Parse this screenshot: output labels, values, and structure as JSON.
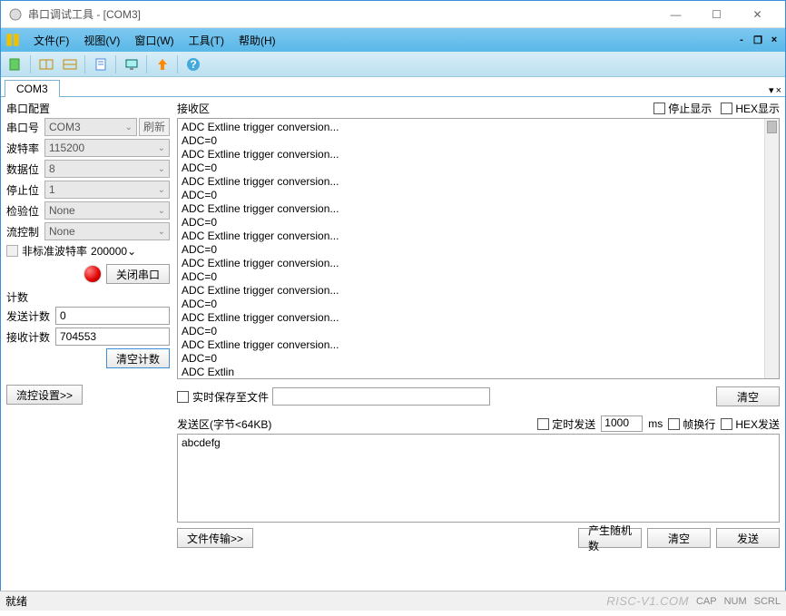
{
  "window": {
    "title": "串口调试工具 - [COM3]"
  },
  "menu": {
    "file": "文件(F)",
    "view": "视图(V)",
    "window": "窗口(W)",
    "tools": "工具(T)",
    "help": "帮助(H)"
  },
  "tab": {
    "label": "COM3"
  },
  "serial_config": {
    "title": "串口配置",
    "port_label": "串口号",
    "port_value": "COM3",
    "refresh": "刷新",
    "baud_label": "波特率",
    "baud_value": "115200",
    "databits_label": "数据位",
    "databits_value": "8",
    "stopbits_label": "停止位",
    "stopbits_value": "1",
    "parity_label": "检验位",
    "parity_value": "None",
    "flow_label": "流控制",
    "flow_value": "None",
    "nonstd_label": "非标准波特率",
    "nonstd_value": "200000",
    "close_port": "关闭串口"
  },
  "counts": {
    "title": "计数",
    "send_label": "发送计数",
    "send_value": "0",
    "recv_label": "接收计数",
    "recv_value": "704553",
    "clear": "清空计数"
  },
  "flow_settings_btn": "流控设置>>",
  "recv": {
    "title": "接收区",
    "stop_display": "停止显示",
    "hex_display": "HEX显示",
    "content": "ADC Extline trigger conversion...\nADC=0\nADC Extline trigger conversion...\nADC=0\nADC Extline trigger conversion...\nADC=0\nADC Extline trigger conversion...\nADC=0\nADC Extline trigger conversion...\nADC=0\nADC Extline trigger conversion...\nADC=0\nADC Extline trigger conversion...\nADC=0\nADC Extline trigger conversion...\nADC=0\nADC Extline trigger conversion...\nADC=0\nADC Extlin"
  },
  "save_file": {
    "label": "实时保存至文件",
    "clear": "清空"
  },
  "send": {
    "title": "发送区(字节<64KB)",
    "timed_label": "定时发送",
    "interval": "1000",
    "ms": "ms",
    "wrap_label": "帧换行",
    "hex_label": "HEX发送",
    "content": "abcdefg",
    "file_transfer": "文件传输>>",
    "random": "产生随机数",
    "clear": "清空",
    "send_btn": "发送"
  },
  "status": {
    "ready": "就绪",
    "watermark": "RISC-V1.COM",
    "cap": "CAP",
    "num": "NUM",
    "scrl": "SCRL"
  }
}
